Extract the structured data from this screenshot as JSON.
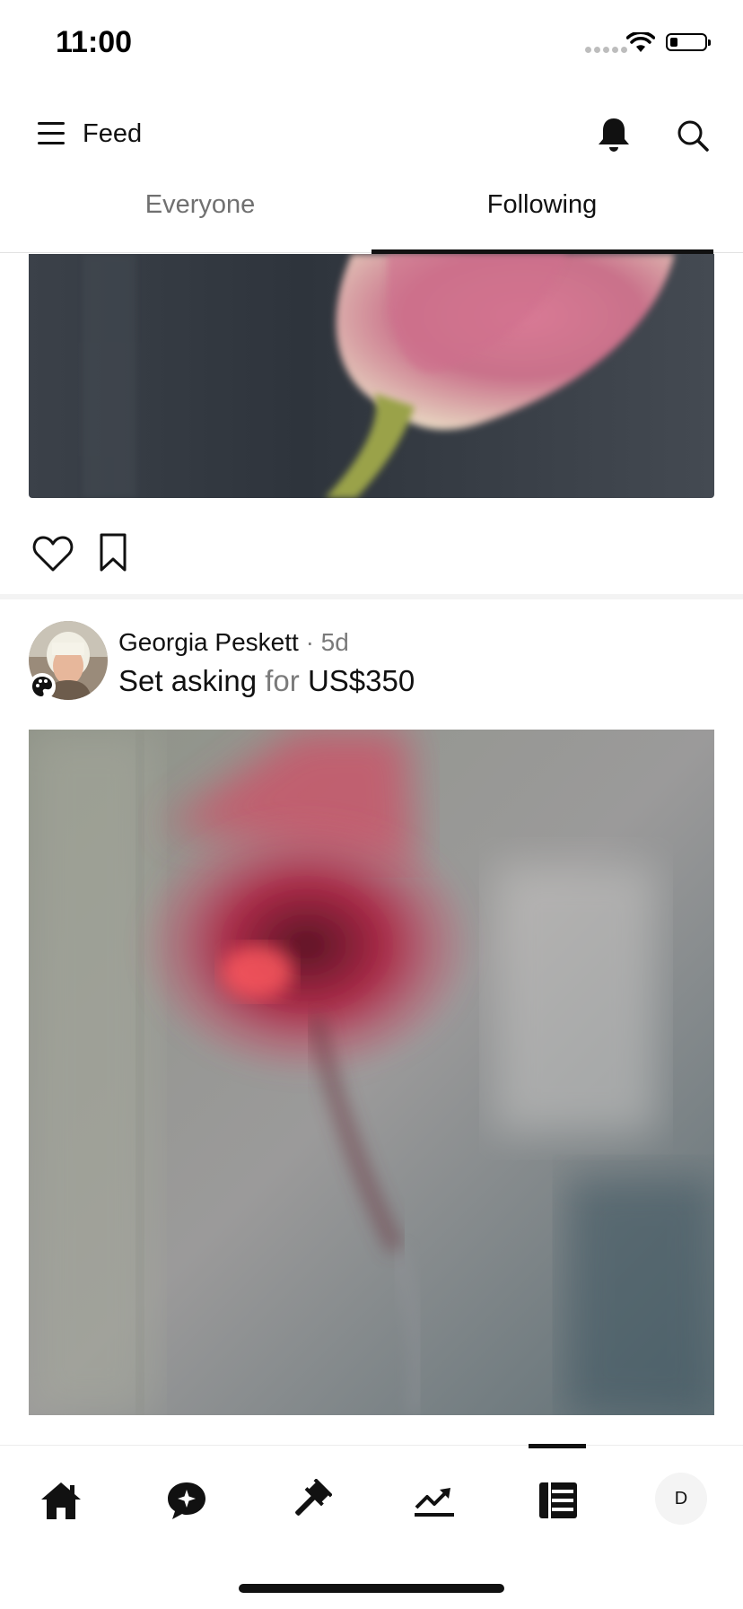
{
  "status_bar": {
    "time": "11:00"
  },
  "header": {
    "title": "Feed"
  },
  "tabs": [
    {
      "label": "Everyone",
      "active": false
    },
    {
      "label": "Following",
      "active": true
    }
  ],
  "post": {
    "author": "Georgia Peskett",
    "separator": "·",
    "age": "5d",
    "action_verb": "Set asking",
    "action_for": "for",
    "price": "US$350"
  },
  "bottom_nav": {
    "items": [
      "home-icon",
      "chat-icon",
      "auction-icon",
      "trends-icon",
      "feed-icon",
      "profile-avatar"
    ],
    "active": "feed-icon",
    "profile_initial": "D"
  },
  "colors": {
    "text": "#111111",
    "muted": "#7a7a7a",
    "active_tab": "#111111",
    "inactive_tab": "#707070"
  }
}
